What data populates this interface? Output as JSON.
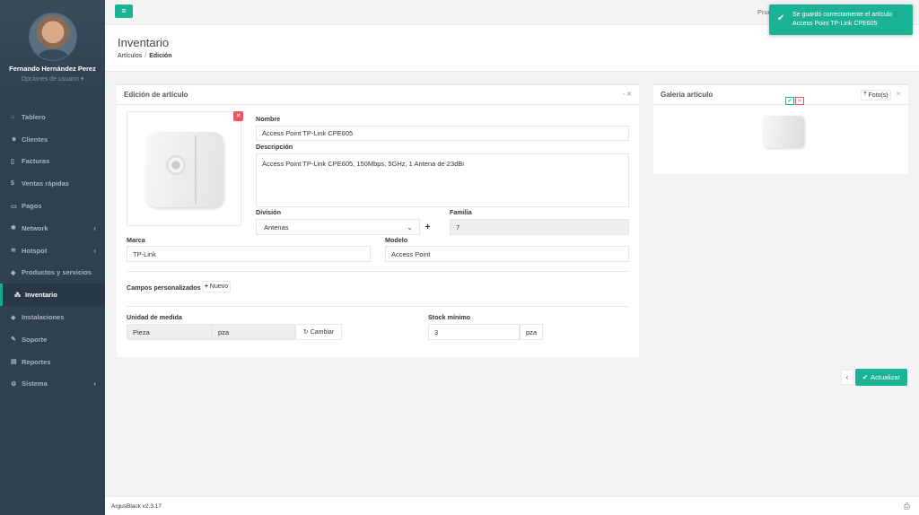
{
  "sidebar": {
    "user_name": "Fernando Hernández Perez",
    "user_options": "Opciones de usuario ▾",
    "items": [
      {
        "label": "Tablero",
        "icon": "dashboard-icon",
        "glyph": "⌂",
        "chevron": ""
      },
      {
        "label": "Clientes",
        "icon": "users-icon",
        "glyph": "☻",
        "chevron": ""
      },
      {
        "label": "Facturas",
        "icon": "document-icon",
        "glyph": "▯",
        "chevron": ""
      },
      {
        "label": "Ventas rápidas",
        "icon": "dollar-icon",
        "glyph": "$",
        "chevron": ""
      },
      {
        "label": "Pagos",
        "icon": "money-icon",
        "glyph": "▭",
        "chevron": ""
      },
      {
        "label": "Network",
        "icon": "network-icon",
        "glyph": "✱",
        "chevron": "‹"
      },
      {
        "label": "Hotspot",
        "icon": "wifi-icon",
        "glyph": "≋",
        "chevron": "‹"
      },
      {
        "label": "Productos y servicios",
        "icon": "tag-icon",
        "glyph": "◆",
        "chevron": ""
      },
      {
        "label": "Inventario",
        "icon": "cubes-icon",
        "glyph": "⁂",
        "chevron": ""
      },
      {
        "label": "Instalaciones",
        "icon": "plug-icon",
        "glyph": "◈",
        "chevron": ""
      },
      {
        "label": "Soporte",
        "icon": "wrench-icon",
        "glyph": "✎",
        "chevron": ""
      },
      {
        "label": "Reportes",
        "icon": "report-icon",
        "glyph": "▤",
        "chevron": ""
      },
      {
        "label": "Sistema",
        "icon": "gears-icon",
        "glyph": "⚙",
        "chevron": "‹"
      }
    ]
  },
  "topbar": {
    "user_text": "Prue"
  },
  "toast": {
    "line1": "Se guardó correctamente el artículo",
    "line2": "Access Point TP-Link CPE605"
  },
  "heading": {
    "title": "Inventario",
    "crumb1": "Artículos",
    "crumb_sep": "/",
    "crumb2": "Edición"
  },
  "edit_panel": {
    "title": "Edición de artículo",
    "nombre_label": "Nombre",
    "nombre_value": "Access Point TP-Link CPE605",
    "descripcion_label": "Descripción",
    "descripcion_value": "Access Point TP-Link CPE605, 150Mbps, 5GHz, 1 Antena de 23dBi",
    "division_label": "División",
    "division_value": "Antenas",
    "familia_label": "Familia",
    "familia_value": "7",
    "marca_label": "Marca",
    "marca_value": "TP-Link",
    "modelo_label": "Modelo",
    "modelo_value": "Access Point",
    "campos_label": "Campos personalizados",
    "nuevo_label": "Nuevo",
    "unidad_label": "Unidad de medida",
    "unidad_value": "Pieza",
    "unidad_abbr": "pza",
    "cambiar_label": "Cambiar",
    "stock_label": "Stock mínimo",
    "stock_value": "3",
    "stock_unit": "pza"
  },
  "gallery_panel": {
    "title": "Galeria artículo",
    "fotos_label": "Foto(s)"
  },
  "actions": {
    "back_label": "‹",
    "update_label": "Actualizar"
  },
  "footer": {
    "version": "ArgusBlack v2.3.17"
  },
  "colors": {
    "accent": "#1ab394",
    "danger": "#ed5565",
    "sidebar": "#2f4050"
  }
}
